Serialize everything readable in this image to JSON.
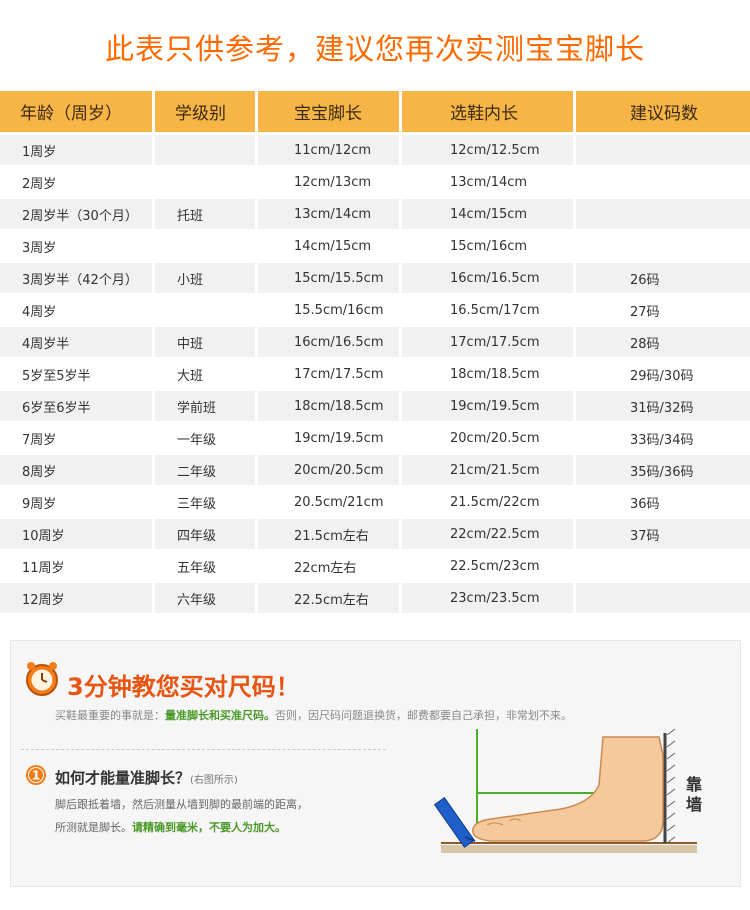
{
  "header": {
    "title": "此表只供参考，建议您再次实测宝宝脚长"
  },
  "table": {
    "columns": [
      "年龄（周岁）",
      "学级别",
      "宝宝脚长",
      "选鞋内长",
      "建议码数"
    ],
    "rows": [
      [
        "1周岁",
        "",
        "11cm/12cm",
        "12cm/12.5cm",
        ""
      ],
      [
        "2周岁",
        "",
        "12cm/13cm",
        "13cm/14cm",
        ""
      ],
      [
        "2周岁半（30个月）",
        "托班",
        "13cm/14cm",
        "14cm/15cm",
        ""
      ],
      [
        "3周岁",
        "",
        "14cm/15cm",
        "15cm/16cm",
        ""
      ],
      [
        "3周岁半（42个月）",
        "小班",
        "15cm/15.5cm",
        "16cm/16.5cm",
        "26码"
      ],
      [
        "4周岁",
        "",
        "15.5cm/16cm",
        "16.5cm/17cm",
        "27码"
      ],
      [
        "4周岁半",
        "中班",
        "16cm/16.5cm",
        "17cm/17.5cm",
        "28码"
      ],
      [
        "5岁至5岁半",
        "大班",
        "17cm/17.5cm",
        "18cm/18.5cm",
        "29码/30码"
      ],
      [
        "6岁至6岁半",
        "学前班",
        "18cm/18.5cm",
        "19cm/19.5cm",
        "31码/32码"
      ],
      [
        "7周岁",
        "一年级",
        "19cm/19.5cm",
        "20cm/20.5cm",
        "33码/34码"
      ],
      [
        "8周岁",
        "二年级",
        "20cm/20.5cm",
        "21cm/21.5cm",
        "35码/36码"
      ],
      [
        "9周岁",
        "三年级",
        "20.5cm/21cm",
        "21.5cm/22cm",
        "36码"
      ],
      [
        "10周岁",
        "四年级",
        "21.5cm左右",
        "22cm/22.5cm",
        "37码"
      ],
      [
        "11周岁",
        "五年级",
        "22cm左右",
        "22.5cm/23cm",
        ""
      ],
      [
        "12周岁",
        "六年级",
        "22.5cm左右",
        "23cm/23.5cm",
        ""
      ]
    ]
  },
  "guide": {
    "title": "3分钟教您买对尺码！",
    "note_before": "买鞋最重要的事就是：",
    "note_highlight": "量准脚长和买准尺码。",
    "note_after": "否则，因尺码问题退换货，邮费都要自己承担，非常划不来。",
    "step_number": "1",
    "step_title": "如何才能量准脚长？",
    "step_subtitle": "(右图所示)",
    "step_line1": "脚后跟抵着墙，然后测量从墙到脚的最前端的距离，",
    "step_line2_before": "所测就是脚长。",
    "step_line2_highlight": "请精确到毫米，不要人为加大。",
    "wall_label": "靠墙",
    "colors": {
      "accent": "#ff6a00",
      "header_bg": "#f7b548",
      "highlight": "#4b9a2a",
      "foot": "#f5c99b"
    },
    "icons": [
      "alarm-clock-icon",
      "step-number-badge",
      "foot-illustration",
      "ruler-icon"
    ]
  }
}
